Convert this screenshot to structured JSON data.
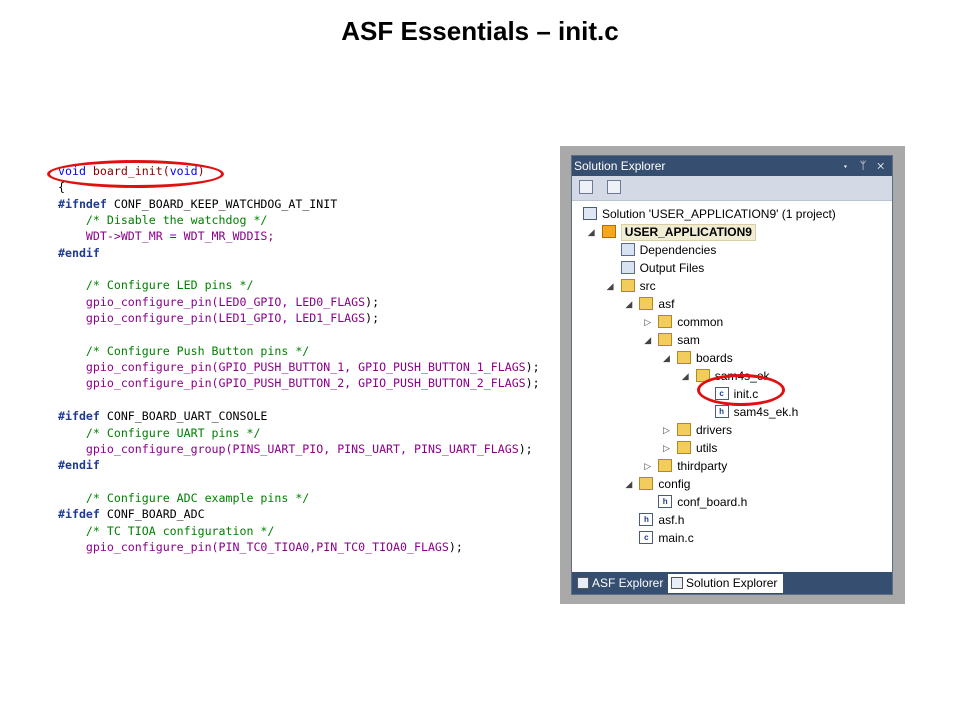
{
  "slide": {
    "title": "ASF Essentials – init.c"
  },
  "code": {
    "lines": [
      [
        {
          "t": "void",
          "c": "kw"
        },
        {
          "t": " board_init(",
          "c": "fn"
        },
        {
          "t": "void",
          "c": "kw"
        },
        {
          "t": ")",
          "c": "fn"
        }
      ],
      [
        {
          "t": "{",
          "c": "pl"
        }
      ],
      [
        {
          "t": "#ifndef",
          "c": "pp"
        },
        {
          "t": " CONF_BOARD_KEEP_WATCHDOG_AT_INIT",
          "c": "pl"
        }
      ],
      [
        {
          "t": "    /* Disable the watchdog */",
          "c": "cm"
        }
      ],
      [
        {
          "t": "    WDT->WDT_MR = WDT_MR_WDDIS;",
          "c": "mac"
        }
      ],
      [
        {
          "t": "#endif",
          "c": "pp"
        }
      ],
      [
        {
          "t": "",
          "c": "pl"
        }
      ],
      [
        {
          "t": "    /* Configure LED pins */",
          "c": "cm"
        }
      ],
      [
        {
          "t": "    gpio_configure_pin(",
          "c": "mac"
        },
        {
          "t": "LED0_GPIO, LED0_FLAGS",
          "c": "mac"
        },
        {
          "t": ");",
          "c": "pl"
        }
      ],
      [
        {
          "t": "    gpio_configure_pin(",
          "c": "mac"
        },
        {
          "t": "LED1_GPIO, LED1_FLAGS",
          "c": "mac"
        },
        {
          "t": ");",
          "c": "pl"
        }
      ],
      [
        {
          "t": "",
          "c": "pl"
        }
      ],
      [
        {
          "t": "    /* Configure Push Button pins */",
          "c": "cm"
        }
      ],
      [
        {
          "t": "    gpio_configure_pin(GPIO_PUSH_BUTTON_1, GPIO_PUSH_BUTTON_1_FLAGS",
          "c": "mac"
        },
        {
          "t": ");",
          "c": "pl"
        }
      ],
      [
        {
          "t": "    gpio_configure_pin(GPIO_PUSH_BUTTON_2, GPIO_PUSH_BUTTON_2_FLAGS",
          "c": "mac"
        },
        {
          "t": ");",
          "c": "pl"
        }
      ],
      [
        {
          "t": "",
          "c": "pl"
        }
      ],
      [
        {
          "t": "#ifdef",
          "c": "pp"
        },
        {
          "t": " CONF_BOARD_UART_CONSOLE",
          "c": "pl"
        }
      ],
      [
        {
          "t": "    /* Configure UART pins */",
          "c": "cm"
        }
      ],
      [
        {
          "t": "    gpio_configure_group(PINS_UART_PIO, PINS_UART, PINS_UART_FLAGS",
          "c": "mac"
        },
        {
          "t": ");",
          "c": "pl"
        }
      ],
      [
        {
          "t": "#endif",
          "c": "pp"
        }
      ],
      [
        {
          "t": "",
          "c": "pl"
        }
      ],
      [
        {
          "t": "    /* Configure ADC example pins */",
          "c": "cm"
        }
      ],
      [
        {
          "t": "#ifdef",
          "c": "pp"
        },
        {
          "t": " CONF_BOARD_ADC",
          "c": "pl"
        }
      ],
      [
        {
          "t": "    /* TC TIOA configuration */",
          "c": "cm"
        }
      ],
      [
        {
          "t": "    gpio_configure_pin(PIN_TC0_TIOA0,PIN_TC0_TIOA0_FLAGS",
          "c": "mac"
        },
        {
          "t": ");",
          "c": "pl"
        }
      ]
    ]
  },
  "solution_explorer": {
    "title": "Solution Explorer",
    "title_controls": "▾ ᛘ ✕",
    "tree": [
      {
        "label": "Solution 'USER_APPLICATION9' (1 project)",
        "depth": 0,
        "icon": "sol",
        "exp": ""
      },
      {
        "label": "USER_APPLICATION9",
        "depth": 1,
        "icon": "proj",
        "exp": "◢",
        "bold": true
      },
      {
        "label": "Dependencies",
        "depth": 2,
        "icon": "deps",
        "exp": ""
      },
      {
        "label": "Output Files",
        "depth": 2,
        "icon": "deps",
        "exp": ""
      },
      {
        "label": "src",
        "depth": 2,
        "icon": "folder",
        "exp": "◢"
      },
      {
        "label": "asf",
        "depth": 3,
        "icon": "folder",
        "exp": "◢"
      },
      {
        "label": "common",
        "depth": 4,
        "icon": "folder",
        "exp": "▷"
      },
      {
        "label": "sam",
        "depth": 4,
        "icon": "folder",
        "exp": "◢"
      },
      {
        "label": "boards",
        "depth": 5,
        "icon": "folder",
        "exp": "◢"
      },
      {
        "label": "sam4s_ek",
        "depth": 6,
        "icon": "folder",
        "exp": "◢"
      },
      {
        "label": "init.c",
        "depth": 7,
        "icon": "cfile",
        "exp": ""
      },
      {
        "label": "sam4s_ek.h",
        "depth": 7,
        "icon": "hfile",
        "exp": ""
      },
      {
        "label": "drivers",
        "depth": 5,
        "icon": "folder",
        "exp": "▷"
      },
      {
        "label": "utils",
        "depth": 5,
        "icon": "folder",
        "exp": "▷"
      },
      {
        "label": "thirdparty",
        "depth": 4,
        "icon": "folder",
        "exp": "▷"
      },
      {
        "label": "config",
        "depth": 3,
        "icon": "folder",
        "exp": "◢"
      },
      {
        "label": "conf_board.h",
        "depth": 4,
        "icon": "hfile",
        "exp": ""
      },
      {
        "label": "asf.h",
        "depth": 3,
        "icon": "hfile",
        "exp": ""
      },
      {
        "label": "main.c",
        "depth": 3,
        "icon": "cfile",
        "exp": ""
      }
    ],
    "tabs": [
      {
        "label": "ASF Explorer"
      },
      {
        "label": "Solution Explorer"
      }
    ]
  }
}
